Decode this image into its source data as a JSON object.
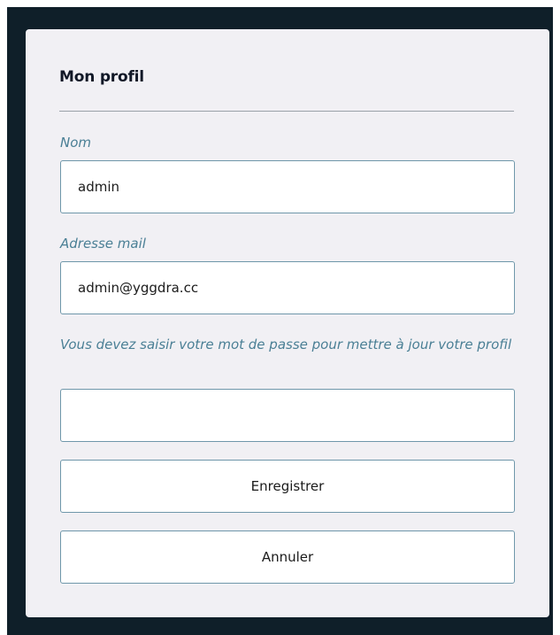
{
  "profile": {
    "title": "Mon profil",
    "fields": [
      {
        "label": "Nom",
        "value": "admin",
        "placeholder": ""
      },
      {
        "label": "Adresse mail",
        "value": "admin@yggdra.cc",
        "placeholder": ""
      },
      {
        "label": "Vous devez saisir votre mot de passe pour mettre à jour votre profil",
        "value": "",
        "placeholder": ""
      }
    ],
    "save_label": "Enregistrer",
    "cancel_label": "Annuler"
  },
  "colors": {
    "backdrop": "#0f1f29",
    "card": "#f1f0f4",
    "label": "#4a7f95",
    "input_border": "#6f97aa"
  }
}
